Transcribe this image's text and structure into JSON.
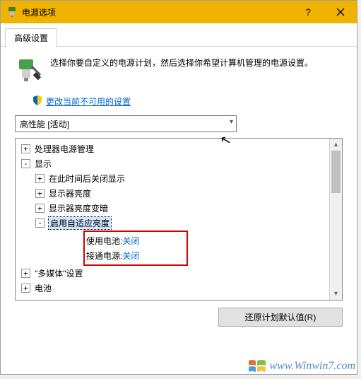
{
  "window": {
    "title": "电源选项"
  },
  "tab": {
    "label": "高级设置"
  },
  "intro": {
    "text": "选择你要自定义的电源计划，然后选择你希望计算机管理的电源设置。"
  },
  "link": {
    "change_unavailable": "更改当前不可用的设置"
  },
  "plan": {
    "selected": "高性能 [活动]"
  },
  "tree": {
    "processor": "处理器电源管理",
    "display": "显示",
    "turn_off_after": "在此时间后关闭显示",
    "brightness": "显示器亮度",
    "dimmed": "显示器亮度变暗",
    "adaptive": "启用自适应亮度",
    "on_battery_label": "使用电池: ",
    "on_battery_value": "关闭",
    "plugged_label": "接通电源: ",
    "plugged_value": "关闭",
    "multimedia": "\"多媒体\"设置",
    "battery": "电池"
  },
  "buttons": {
    "restore_defaults": "还原计划默认值(R)"
  },
  "watermark": {
    "text": "www.Winwin7.com"
  }
}
